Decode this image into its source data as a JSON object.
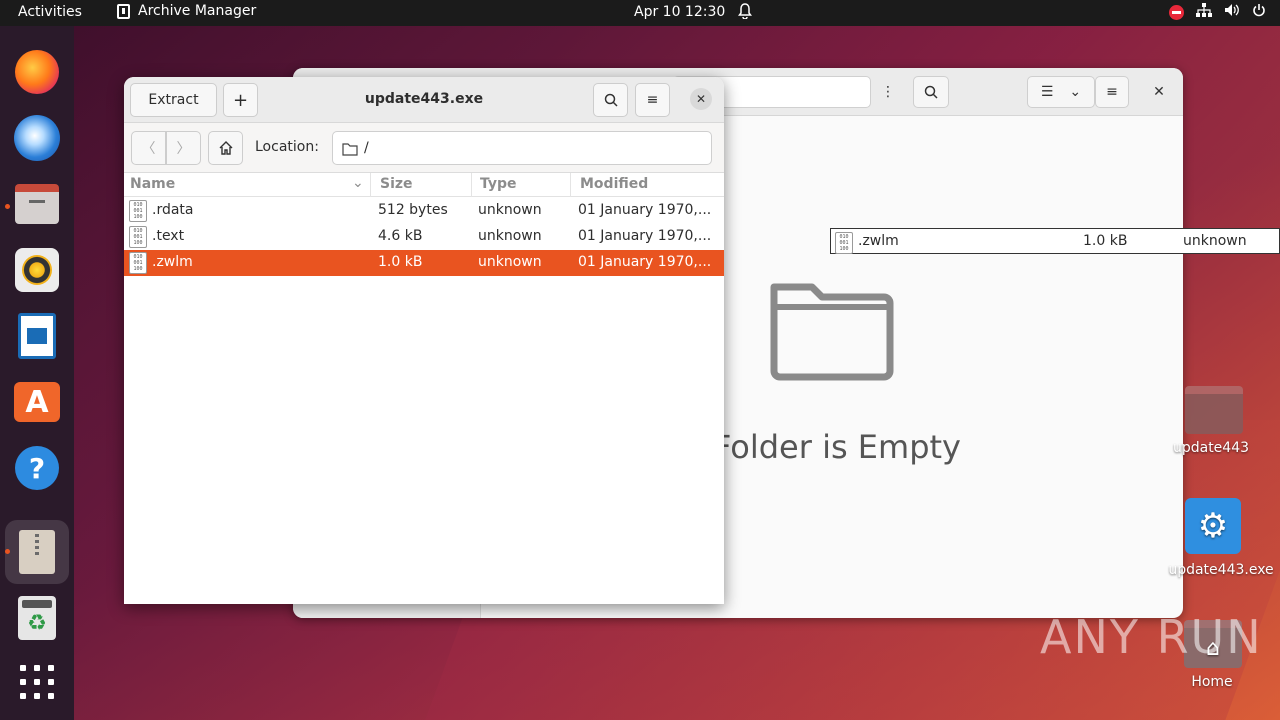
{
  "topbar": {
    "activities": "Activities",
    "app_name": "Archive Manager",
    "clock": "Apr 10  12:30"
  },
  "archive_window": {
    "title": "update443.exe",
    "extract_label": "Extract",
    "add_label": "+",
    "location_label": "Location:",
    "location_value": "/",
    "columns": {
      "name": "Name",
      "size": "Size",
      "type": "Type",
      "modified": "Modified"
    },
    "files": [
      {
        "name": ".rdata",
        "size": "512 bytes",
        "type": "unknown",
        "modified": "01 January 1970,..."
      },
      {
        "name": ".text",
        "size": "4.6 kB",
        "type": "unknown",
        "modified": "01 January 1970,..."
      },
      {
        "name": ".zwlm",
        "size": "1.0 kB",
        "type": "unknown",
        "modified": "01 January 1970,...",
        "selected": true
      }
    ]
  },
  "drag_ghost": {
    "name": ".zwlm",
    "size": "1.0 kB",
    "type": "unknown"
  },
  "file_manager": {
    "empty_text": "Folder is Empty"
  },
  "desktop": {
    "icons": [
      {
        "label": "update443"
      },
      {
        "label": "update443.exe"
      },
      {
        "label": "Home"
      }
    ]
  },
  "watermark": "ANY RUN",
  "colors": {
    "accent": "#e95420",
    "topbar": "#1b1b1b"
  }
}
